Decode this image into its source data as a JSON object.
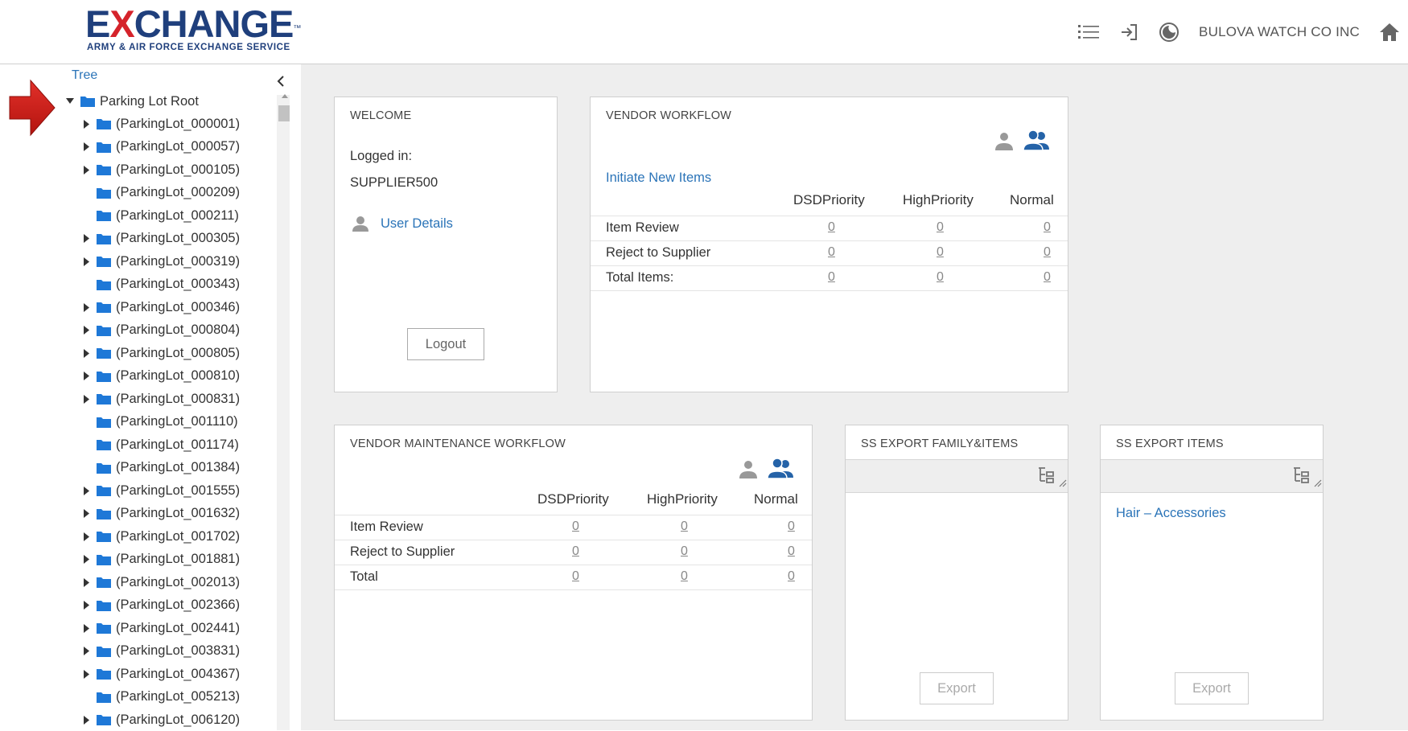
{
  "header": {
    "logo_main_prefix": "E",
    "logo_main_x": "X",
    "logo_main_rest": "CHANGE",
    "logo_tm": "™",
    "logo_sub": "ARMY & AIR FORCE EXCHANGE SERVICE",
    "company": "BULOVA WATCH CO INC"
  },
  "sidebar": {
    "tree_label": "Tree",
    "root_label": "Parking Lot Root",
    "nodes": [
      {
        "label": "(ParkingLot_000001)",
        "expandable": true
      },
      {
        "label": "(ParkingLot_000057)",
        "expandable": true
      },
      {
        "label": "(ParkingLot_000105)",
        "expandable": true
      },
      {
        "label": "(ParkingLot_000209)",
        "expandable": false
      },
      {
        "label": "(ParkingLot_000211)",
        "expandable": false
      },
      {
        "label": "(ParkingLot_000305)",
        "expandable": true
      },
      {
        "label": "(ParkingLot_000319)",
        "expandable": true
      },
      {
        "label": "(ParkingLot_000343)",
        "expandable": false
      },
      {
        "label": "(ParkingLot_000346)",
        "expandable": true
      },
      {
        "label": "(ParkingLot_000804)",
        "expandable": true
      },
      {
        "label": "(ParkingLot_000805)",
        "expandable": true
      },
      {
        "label": "(ParkingLot_000810)",
        "expandable": true
      },
      {
        "label": "(ParkingLot_000831)",
        "expandable": true
      },
      {
        "label": "(ParkingLot_001110)",
        "expandable": false
      },
      {
        "label": "(ParkingLot_001174)",
        "expandable": false
      },
      {
        "label": "(ParkingLot_001384)",
        "expandable": false
      },
      {
        "label": "(ParkingLot_001555)",
        "expandable": true
      },
      {
        "label": "(ParkingLot_001632)",
        "expandable": true
      },
      {
        "label": "(ParkingLot_001702)",
        "expandable": true
      },
      {
        "label": "(ParkingLot_001881)",
        "expandable": true
      },
      {
        "label": "(ParkingLot_002013)",
        "expandable": true
      },
      {
        "label": "(ParkingLot_002366)",
        "expandable": true
      },
      {
        "label": "(ParkingLot_002441)",
        "expandable": true
      },
      {
        "label": "(ParkingLot_003831)",
        "expandable": true
      },
      {
        "label": "(ParkingLot_004367)",
        "expandable": true
      },
      {
        "label": "(ParkingLot_005213)",
        "expandable": false
      },
      {
        "label": "(ParkingLot_006120)",
        "expandable": true
      }
    ]
  },
  "welcome": {
    "title": "WELCOME",
    "logged_in_label": "Logged in:",
    "username": "SUPPLIER500",
    "user_details_link": "User Details",
    "logout_label": "Logout"
  },
  "vendor_workflow": {
    "title": "VENDOR WORKFLOW",
    "initiate_link": "Initiate New Items",
    "columns": [
      "DSDPriority",
      "HighPriority",
      "Normal"
    ],
    "rows": [
      {
        "label": "Item Review",
        "values": [
          "0",
          "0",
          "0"
        ]
      },
      {
        "label": "Reject to Supplier",
        "values": [
          "0",
          "0",
          "0"
        ]
      },
      {
        "label": "Total Items:",
        "values": [
          "0",
          "0",
          "0"
        ]
      }
    ]
  },
  "vendor_maintenance": {
    "title": "VENDOR MAINTENANCE WORKFLOW",
    "columns": [
      "DSDPriority",
      "HighPriority",
      "Normal"
    ],
    "rows": [
      {
        "label": "Item Review",
        "values": [
          "0",
          "0",
          "0"
        ]
      },
      {
        "label": "Reject to Supplier",
        "values": [
          "0",
          "0",
          "0"
        ]
      },
      {
        "label": "Total",
        "values": [
          "0",
          "0",
          "0"
        ]
      }
    ]
  },
  "ss_export_family": {
    "title": "SS EXPORT FAMILY&ITEMS",
    "export_label": "Export"
  },
  "ss_export_items": {
    "title": "SS EXPORT ITEMS",
    "item_link": "Hair – Accessories",
    "export_label": "Export"
  },
  "colors": {
    "brand_blue": "#1f3f7c",
    "brand_red": "#d5232b",
    "link_blue": "#2b74b8",
    "folder_blue": "#1e78d7",
    "pointer_arrow": "#d0201e"
  }
}
